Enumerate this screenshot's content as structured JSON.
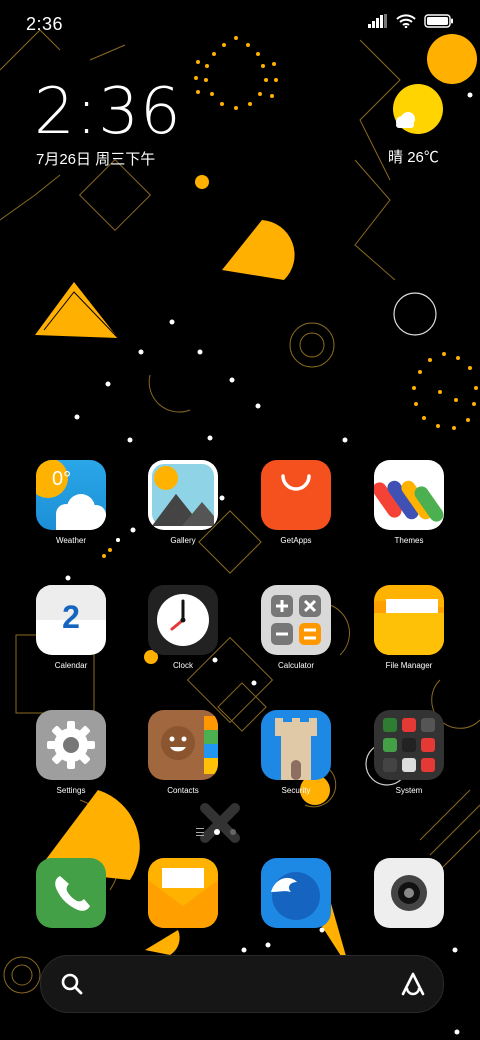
{
  "status_bar": {
    "time": "2:36",
    "icons": [
      "signal-icon",
      "wifi-icon",
      "battery-icon"
    ]
  },
  "clock_widget": {
    "time": "2:36",
    "date": "7月26日 周三下午"
  },
  "weather_widget": {
    "condition": "晴",
    "temperature": "26℃",
    "icon": "sun-cloud-icon"
  },
  "apps": [
    {
      "label": "Weather",
      "icon": "weather-icon",
      "temp": "0°"
    },
    {
      "label": "Gallery",
      "icon": "gallery-icon"
    },
    {
      "label": "GetApps",
      "icon": "getapps-icon"
    },
    {
      "label": "Themes",
      "icon": "themes-icon"
    },
    {
      "label": "Calendar",
      "icon": "calendar-icon",
      "day": "2"
    },
    {
      "label": "Clock",
      "icon": "clock-icon"
    },
    {
      "label": "Calculator",
      "icon": "calculator-icon"
    },
    {
      "label": "File Manager",
      "icon": "folder-icon"
    },
    {
      "label": "Settings",
      "icon": "gear-icon"
    },
    {
      "label": "Contacts",
      "icon": "contacts-icon"
    },
    {
      "label": "Security",
      "icon": "security-icon"
    },
    {
      "label": "System",
      "icon": "system-folder-icon"
    }
  ],
  "dock": [
    {
      "icon": "phone-icon"
    },
    {
      "icon": "messages-icon"
    },
    {
      "icon": "browser-icon"
    },
    {
      "icon": "camera-icon"
    }
  ],
  "page_indicator": {
    "pages": 2,
    "current": 1
  },
  "search_bar": {
    "left_icon": "search-icon",
    "right_icon": "assistant-icon"
  },
  "colors": {
    "accent": "#FFB000",
    "background": "#000000",
    "line": "#C08A1A"
  }
}
